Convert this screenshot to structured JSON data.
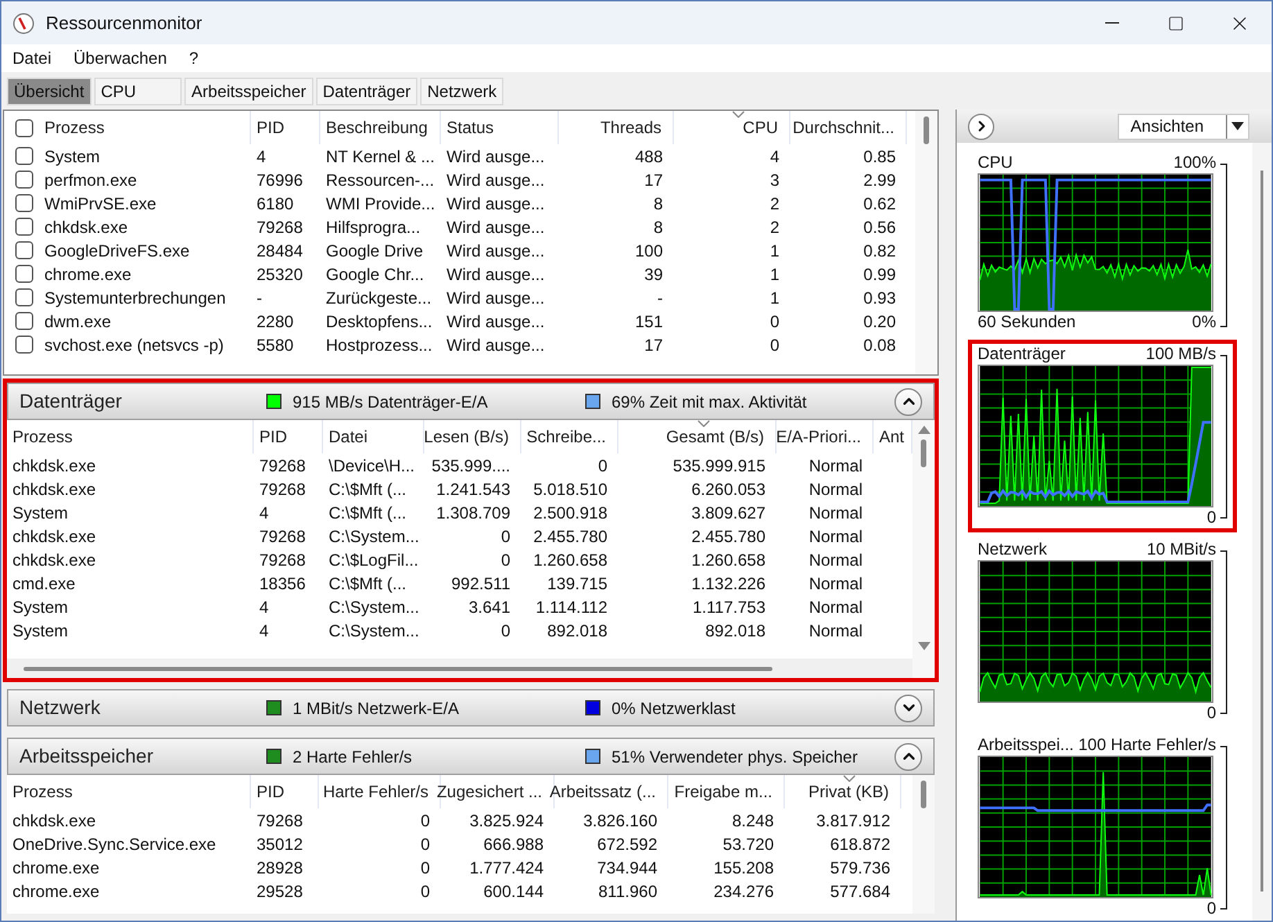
{
  "window": {
    "title": "Ressourcenmonitor"
  },
  "menu": [
    "Datei",
    "Überwachen",
    "?"
  ],
  "tabs": [
    {
      "label": "Übersicht",
      "selected": true
    },
    {
      "label": "CPU",
      "selected": false
    },
    {
      "label": "Arbeitsspeicher",
      "selected": false
    },
    {
      "label": "Datenträger",
      "selected": false
    },
    {
      "label": "Netzwerk",
      "selected": false
    }
  ],
  "overview": {
    "header_checked": false,
    "columns": [
      {
        "label": "Prozess",
        "kind": "text",
        "sorted": false
      },
      {
        "label": "PID",
        "kind": "text",
        "sorted": false
      },
      {
        "label": "Beschreibung",
        "kind": "text",
        "sorted": false
      },
      {
        "label": "Status",
        "kind": "text",
        "sorted": false
      },
      {
        "label": "Threads",
        "kind": "number",
        "sorted": false
      },
      {
        "label": "CPU",
        "kind": "number",
        "sorted": true
      },
      {
        "label": "Durchschnit...",
        "kind": "number",
        "sorted": false
      }
    ],
    "rows": [
      {
        "checked": false,
        "cells": [
          "System",
          "4",
          "NT Kernel & ...",
          "Wird ausge...",
          "488",
          "4",
          "0.85"
        ]
      },
      {
        "checked": false,
        "cells": [
          "perfmon.exe",
          "76996",
          "Ressourcen-...",
          "Wird ausge...",
          "17",
          "3",
          "2.99"
        ]
      },
      {
        "checked": false,
        "cells": [
          "WmiPrvSE.exe",
          "6180",
          "WMI Provide...",
          "Wird ausge...",
          "8",
          "2",
          "0.62"
        ]
      },
      {
        "checked": false,
        "cells": [
          "chkdsk.exe",
          "79268",
          "Hilfsprogra...",
          "Wird ausge...",
          "8",
          "2",
          "0.56"
        ]
      },
      {
        "checked": false,
        "cells": [
          "GoogleDriveFS.exe",
          "28484",
          "Google Drive",
          "Wird ausge...",
          "100",
          "1",
          "0.82"
        ]
      },
      {
        "checked": false,
        "cells": [
          "chrome.exe",
          "25320",
          "Google Chr...",
          "Wird ausge...",
          "39",
          "1",
          "0.99"
        ]
      },
      {
        "checked": false,
        "cells": [
          "Systemunterbrechungen",
          "-",
          "Zurückgeste...",
          "Wird ausge...",
          "-",
          "1",
          "0.93"
        ]
      },
      {
        "checked": false,
        "cells": [
          "dwm.exe",
          "2280",
          "Desktopfens...",
          "Wird ausge...",
          "151",
          "0",
          "0.20"
        ]
      },
      {
        "checked": false,
        "cells": [
          "svchost.exe (netsvcs -p)",
          "5580",
          "Hostprozess...",
          "Wird ausge...",
          "17",
          "0",
          "0.08"
        ]
      }
    ]
  },
  "sections": [
    {
      "title": "Datenträger",
      "highlighted": true,
      "expanded": true,
      "legend": [
        {
          "text": "915 MB/s Datenträger-E/A",
          "color": "#00ff00"
        },
        {
          "text": "69% Zeit mit max. Aktivität",
          "color": "#6aa6ee"
        }
      ],
      "table": {
        "columns": [
          {
            "label": "Prozess",
            "kind": "text",
            "sorted": false
          },
          {
            "label": "PID",
            "kind": "text",
            "sorted": false
          },
          {
            "label": "Datei",
            "kind": "text",
            "sorted": false
          },
          {
            "label": "Lesen (B/s)",
            "kind": "number",
            "sorted": false
          },
          {
            "label": "Schreibe...",
            "kind": "number",
            "sorted": false
          },
          {
            "label": "Gesamt (B/s)",
            "kind": "number",
            "sorted": true
          },
          {
            "label": "E/A-Priori...",
            "kind": "number",
            "sorted": false
          },
          {
            "label": "Ant",
            "kind": "text",
            "sorted": false
          }
        ],
        "rows": [
          [
            "chkdsk.exe",
            "79268",
            "\\Device\\H...",
            "535.999....",
            "0",
            "535.999.915",
            "Normal"
          ],
          [
            "chkdsk.exe",
            "79268",
            "C:\\$Mft (...",
            "1.241.543",
            "5.018.510",
            "6.260.053",
            "Normal"
          ],
          [
            "System",
            "4",
            "C:\\$Mft (...",
            "1.308.709",
            "2.500.918",
            "3.809.627",
            "Normal"
          ],
          [
            "chkdsk.exe",
            "79268",
            "C:\\System...",
            "0",
            "2.455.780",
            "2.455.780",
            "Normal"
          ],
          [
            "chkdsk.exe",
            "79268",
            "C:\\$LogFil...",
            "0",
            "1.260.658",
            "1.260.658",
            "Normal"
          ],
          [
            "cmd.exe",
            "18356",
            "C:\\$Mft (...",
            "992.511",
            "139.715",
            "1.132.226",
            "Normal"
          ],
          [
            "System",
            "4",
            "C:\\System...",
            "3.641",
            "1.114.112",
            "1.117.753",
            "Normal"
          ],
          [
            "System",
            "4",
            "C:\\System...",
            "0",
            "892.018",
            "892.018",
            "Normal"
          ]
        ]
      }
    },
    {
      "title": "Netzwerk",
      "highlighted": false,
      "expanded": false,
      "legend": [
        {
          "text": "1 MBit/s Netzwerk-E/A",
          "color": "#1e8c1e"
        },
        {
          "text": "0% Netzwerklast",
          "color": "#0000e0"
        }
      ]
    },
    {
      "title": "Arbeitsspeicher",
      "highlighted": false,
      "expanded": true,
      "legend": [
        {
          "text": "2 Harte Fehler/s",
          "color": "#1e8c1e"
        },
        {
          "text": "51% Verwendeter phys. Speicher",
          "color": "#6aa6ee"
        }
      ],
      "table": {
        "columns": [
          {
            "label": "Prozess",
            "kind": "text",
            "sorted": false
          },
          {
            "label": "PID",
            "kind": "text",
            "sorted": false
          },
          {
            "label": "Harte Fehler/s",
            "kind": "number",
            "sorted": false
          },
          {
            "label": "Zugesichert ...",
            "kind": "number",
            "sorted": false
          },
          {
            "label": "Arbeitssatz (...",
            "kind": "number",
            "sorted": false
          },
          {
            "label": "Freigabe m...",
            "kind": "number",
            "sorted": false
          },
          {
            "label": "Privat (KB)",
            "kind": "number",
            "sorted": true
          }
        ],
        "rows": [
          [
            "chkdsk.exe",
            "79268",
            "0",
            "3.825.924",
            "3.826.160",
            "8.248",
            "3.817.912"
          ],
          [
            "OneDrive.Sync.Service.exe",
            "35012",
            "0",
            "666.988",
            "672.592",
            "53.720",
            "618.872"
          ],
          [
            "chrome.exe",
            "28928",
            "0",
            "1.777.424",
            "734.944",
            "155.208",
            "579.736"
          ],
          [
            "chrome.exe",
            "29528",
            "0",
            "600.144",
            "811.960",
            "234.276",
            "577.684"
          ]
        ]
      }
    }
  ],
  "side_panel": {
    "views_button": "Ansichten",
    "graphs": [
      {
        "kind": "cpu",
        "title": "CPU",
        "max": "100%",
        "footer": "60 Sekunden",
        "min": "0%",
        "highlighted": false
      },
      {
        "kind": "disk",
        "title": "Datenträger",
        "max": "100 MB/s",
        "min": "0",
        "highlighted": true
      },
      {
        "kind": "network",
        "title": "Netzwerk",
        "max": "10 MBit/s",
        "min": "0",
        "highlighted": false
      },
      {
        "kind": "memory",
        "title": "Arbeitsspei...",
        "max": "100 Harte Fehler/s",
        "min": "0",
        "highlighted": false
      }
    ]
  }
}
